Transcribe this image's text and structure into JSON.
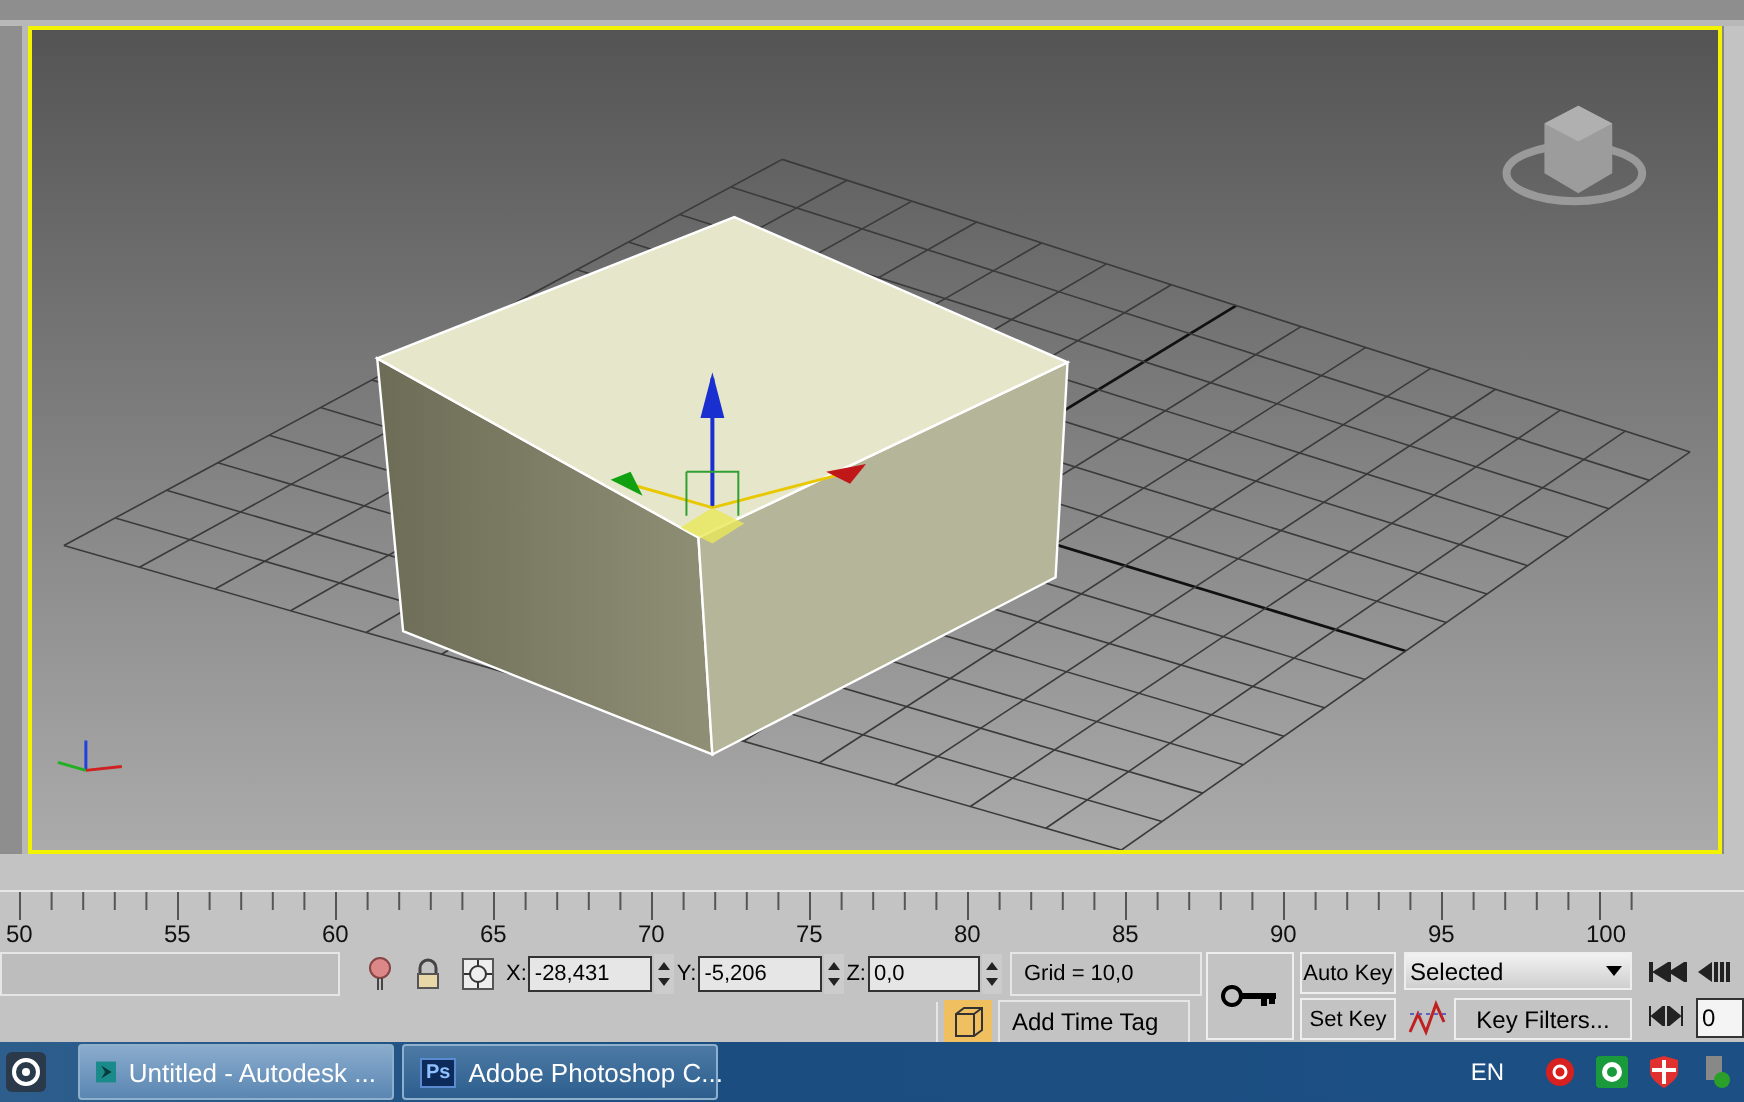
{
  "timeline": {
    "ticks": [
      "50",
      "55",
      "60",
      "65",
      "70",
      "75",
      "80",
      "85",
      "90",
      "95",
      "100"
    ]
  },
  "coords": [
    {
      "axis": "X:",
      "value": "-28,431"
    },
    {
      "axis": "Y:",
      "value": "-5,206"
    },
    {
      "axis": "Z:",
      "value": "0,0"
    }
  ],
  "grid_readout": "Grid = 10,0",
  "time_tag": "Add Time Tag",
  "auto_key": "Auto Key",
  "set_key": "Set Key",
  "key_mode": "Selected",
  "key_filters": "Key Filters...",
  "frame": "0",
  "taskbar": {
    "tasks": [
      {
        "kind": "max",
        "label": "Untitled - Autodesk ...",
        "selected": true
      },
      {
        "kind": "photoshop",
        "icon_text": "Ps",
        "label": "Adobe Photoshop C...",
        "selected": false
      }
    ],
    "language": "EN"
  }
}
